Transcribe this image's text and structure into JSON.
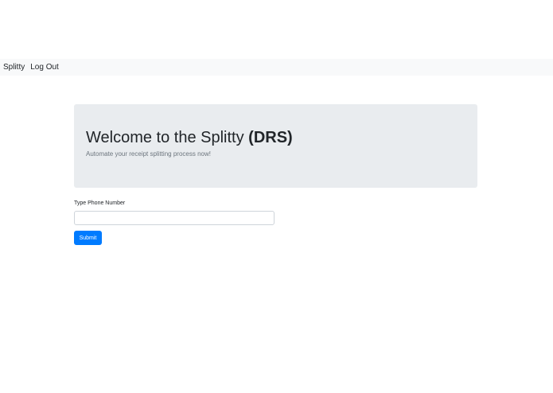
{
  "navbar": {
    "brand": "Splitty",
    "logout": "Log Out"
  },
  "jumbotron": {
    "title_prefix": "Welcome to the Splitty ",
    "title_bold": "(DRS)",
    "lead": "Automate your receipt splitting process now!"
  },
  "form": {
    "phone_label": "Type Phone Number",
    "phone_value": "",
    "phone_placeholder": "",
    "submit_label": "Submit"
  },
  "colors": {
    "navbar_bg": "#f8f9fa",
    "jumbotron_bg": "#e9ecef",
    "primary": "#007bff",
    "lead_text": "#6c757d"
  }
}
